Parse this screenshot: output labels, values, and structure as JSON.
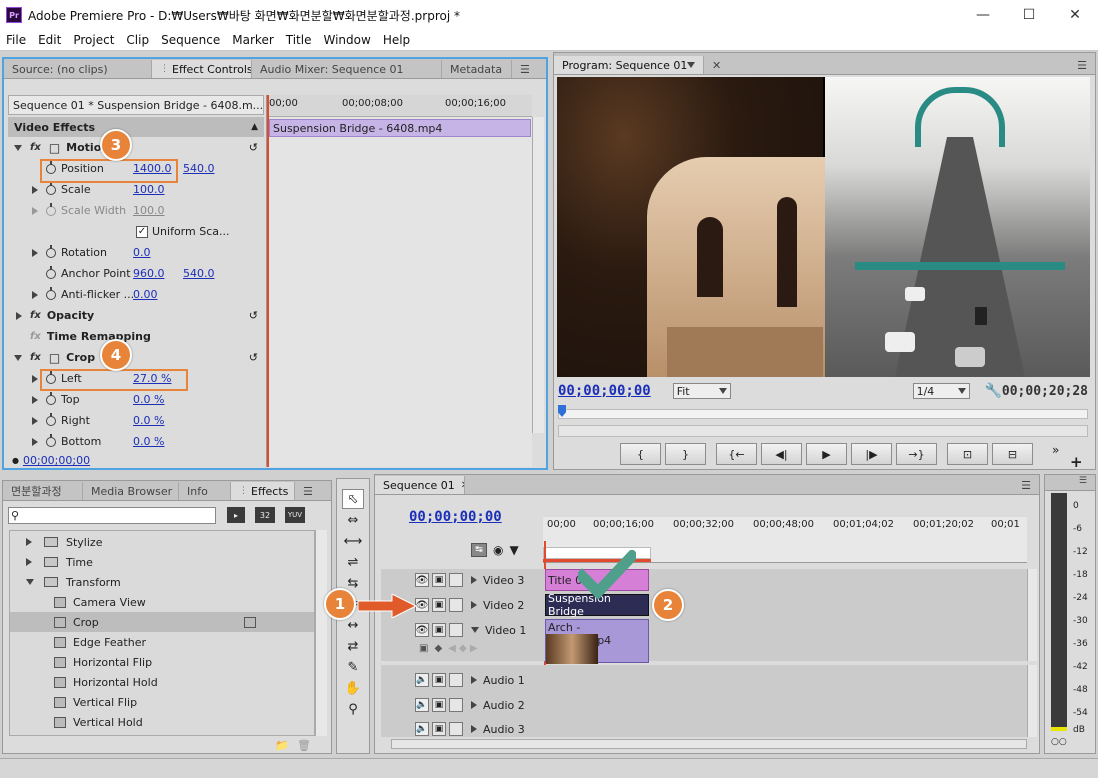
{
  "window": {
    "title": "Adobe Premiere Pro - D:₩Users₩바탕 화면₩화면분할₩화면분할과정.prproj *",
    "app_icon": "Pr"
  },
  "menu": [
    "File",
    "Edit",
    "Project",
    "Clip",
    "Sequence",
    "Marker",
    "Title",
    "Window",
    "Help"
  ],
  "source_panel": {
    "tabs": [
      "Source: (no clips)",
      "Effect Controls",
      "Audio Mixer: Sequence 01",
      "Metadata"
    ],
    "sequence_label": "Sequence 01 * Suspension Bridge - 6408.m...",
    "timecodes": [
      "00;00",
      "00;00;08;00",
      "00;00;16;00"
    ],
    "clip_bar": "Suspension Bridge - 6408.mp4",
    "header": "Video Effects",
    "motion": "Motion",
    "position_label": "Position",
    "position_x": "1400.0",
    "position_y": "540.0",
    "scale_label": "Scale",
    "scale": "100.0",
    "scale_width_label": "Scale Width",
    "scale_width": "100.0",
    "uniform_scale": "Uniform Sca...",
    "rotation_label": "Rotation",
    "rotation": "0.0",
    "anchor_label": "Anchor Point",
    "anchor_x": "960.0",
    "anchor_y": "540.0",
    "antiflicker_label": "Anti-flicker ...",
    "antiflicker": "0.00",
    "opacity": "Opacity",
    "time_remap": "Time Remapping",
    "crop": "Crop",
    "left_label": "Left",
    "left": "27.0",
    "top_label": "Top",
    "top": "0.0",
    "right_label": "Right",
    "right": "0.0",
    "bottom_label": "Bottom",
    "bottom": "0.0",
    "pct": "%",
    "footer_tc": "00;00;00;00"
  },
  "program": {
    "tab": "Program: Sequence 01",
    "tc": "00;00;00;00",
    "fit": "Fit",
    "res": "1/4",
    "duration": "00;00;20;28",
    "buttons": [
      "{",
      "}",
      "{←",
      "◀|",
      "▶",
      "|▶",
      "→}",
      "⊡",
      "⊟"
    ]
  },
  "effects_panel": {
    "tabs": [
      "면분할과정",
      "Media Browser",
      "Info",
      "Effects"
    ],
    "badges": [
      "32",
      "YUV"
    ],
    "items": [
      {
        "label": "Stylize",
        "kind": "folder"
      },
      {
        "label": "Time",
        "kind": "folder"
      },
      {
        "label": "Transform",
        "kind": "folder-open"
      },
      {
        "label": "Camera View",
        "kind": "preset"
      },
      {
        "label": "Crop",
        "kind": "preset",
        "selected": true
      },
      {
        "label": "Edge Feather",
        "kind": "preset"
      },
      {
        "label": "Horizontal Flip",
        "kind": "preset"
      },
      {
        "label": "Horizontal Hold",
        "kind": "preset"
      },
      {
        "label": "Vertical Flip",
        "kind": "preset"
      },
      {
        "label": "Vertical Hold",
        "kind": "preset"
      }
    ]
  },
  "timeline": {
    "tab": "Sequence 01",
    "tc": "00;00;00;00",
    "ruler": [
      "00;00",
      "00;00;16;00",
      "00;00;32;00",
      "00;00;48;00",
      "00;01;04;02",
      "00;01;20;02",
      "00;01"
    ],
    "tracks": [
      "Video 3",
      "Video 2",
      "Video 1",
      "Audio 1",
      "Audio 2",
      "Audio 3"
    ],
    "clips": {
      "v3": "Title 0",
      "v2": "Suspension Bridge",
      "v1": "Arch - 30121.mp4"
    }
  },
  "meter": {
    "labels": [
      "0",
      "-6",
      "-12",
      "-18",
      "-24",
      "-30",
      "-36",
      "-42",
      "-48",
      "-54",
      "dB"
    ]
  },
  "callouts": [
    "1",
    "2",
    "3",
    "4"
  ]
}
